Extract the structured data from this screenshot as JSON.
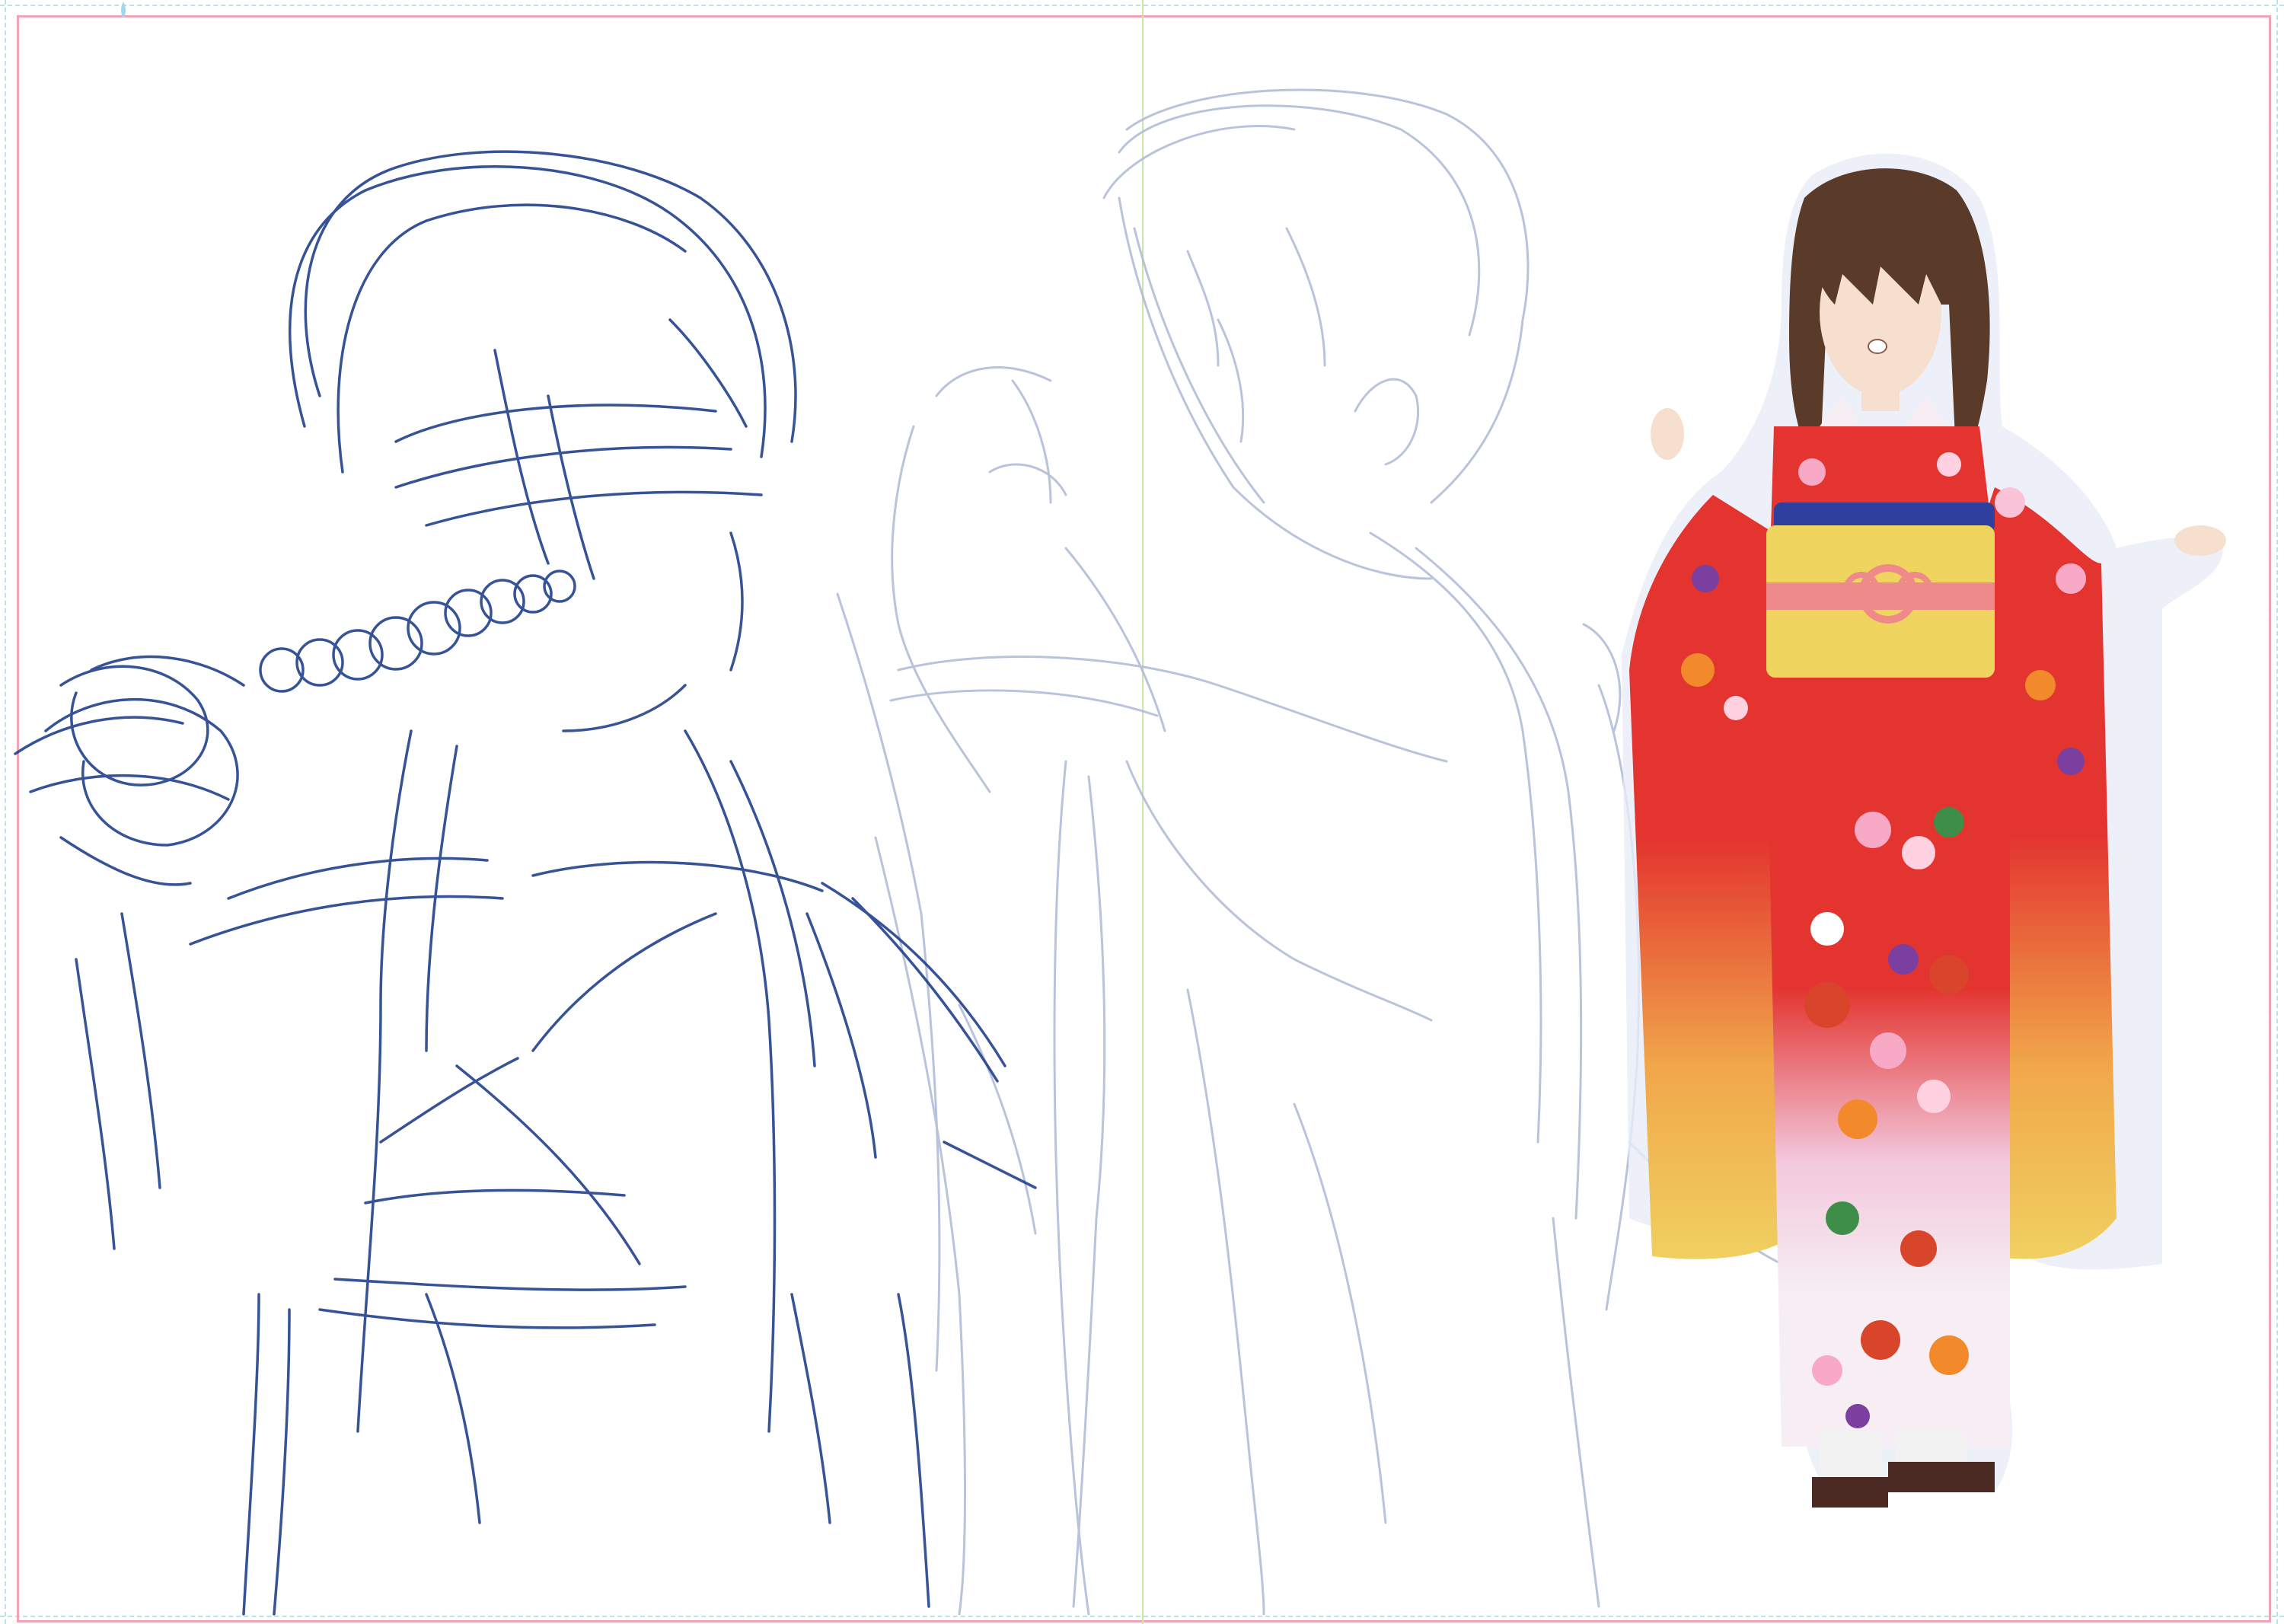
{
  "canvas": {
    "background": "#ffffff",
    "frame_color": "#f0a5b6",
    "guide_color": "#b8e4ea",
    "center_guide_color": "#c9e6a6"
  },
  "layers": {
    "rough_sketch_dark": {
      "stroke": "#22418c"
    },
    "rough_sketch_faded": {
      "stroke": "#aeb9d6"
    },
    "colored_figure": {
      "hair": "#5a3b2a",
      "skin": "#f6dfcf",
      "kimono_top": "#e3342f",
      "kimono_bottom": "#f0d060",
      "hem": "#f6eef2",
      "obi": "#f0d460",
      "obi_band": "#2f3f9e",
      "obi_cord": "#ef8a8a",
      "sandals": "#4a2a22"
    }
  },
  "icons": {
    "ruler_marker": "droplet-icon"
  }
}
